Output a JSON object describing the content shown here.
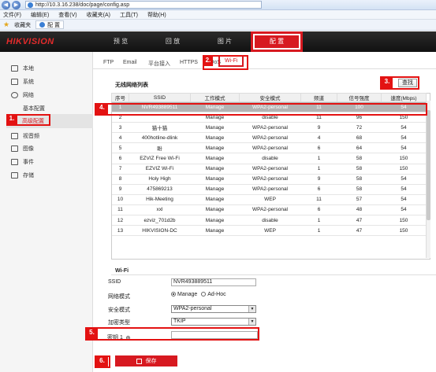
{
  "browser": {
    "url": "http://10.3.16.238/doc/page/config.asp",
    "menu": [
      "文件(F)",
      "编辑(E)",
      "查看(V)",
      "收藏夹(A)",
      "工具(T)",
      "帮助(H)"
    ],
    "favorites_label": "收藏夹",
    "tab_title": "配 置"
  },
  "app": {
    "logo": "HIKVISION",
    "main_tabs": [
      "预 览",
      "回 放",
      "图 片",
      "配 置"
    ]
  },
  "sidebar": {
    "local": "本地",
    "system": "系统",
    "network": "网络",
    "basic_config": "基本配置",
    "advanced_config": "高级配置",
    "video_audio": "视音频",
    "image": "图像",
    "event": "事件",
    "storage": "存储"
  },
  "subtabs": [
    "FTP",
    "Email",
    "平台接入",
    "HTTPS",
    "QoS",
    "Wi-Fi"
  ],
  "wifi_list": {
    "title": "无线网络列表",
    "search_label": "查找",
    "headers": [
      "序号",
      "SSID",
      "工作模式",
      "安全模式",
      "频道",
      "信号强度",
      "速度(Mbps)"
    ],
    "rows": [
      [
        "1",
        "NVR493889511",
        "Manage",
        "WPA2-personal",
        "11",
        "100",
        "54"
      ],
      [
        "2",
        "",
        "Manage",
        "disable",
        "11",
        "96",
        "150"
      ],
      [
        "3",
        "猫十猫",
        "Manage",
        "WPA2-personal",
        "9",
        "72",
        "54"
      ],
      [
        "4",
        "400hotline-dlink",
        "Manage",
        "WPA2-personal",
        "4",
        "68",
        "54"
      ],
      [
        "5",
        "盼",
        "Manage",
        "WPA2-personal",
        "6",
        "64",
        "54"
      ],
      [
        "6",
        "EZVIZ Free Wi-Fi",
        "Manage",
        "disable",
        "1",
        "58",
        "150"
      ],
      [
        "7",
        "EZVIZ Wi-Fi",
        "Manage",
        "WPA2-personal",
        "1",
        "58",
        "150"
      ],
      [
        "8",
        "Holy High",
        "Manage",
        "WPA2-personal",
        "9",
        "58",
        "54"
      ],
      [
        "9",
        "475869213",
        "Manage",
        "WPA2-personal",
        "6",
        "58",
        "54"
      ],
      [
        "10",
        "Hik-Meeting",
        "Manage",
        "WEP",
        "11",
        "57",
        "54"
      ],
      [
        "11",
        "xxl",
        "Manage",
        "WPA2-personal",
        "6",
        "48",
        "54"
      ],
      [
        "12",
        "ezviz_701d2b",
        "Manage",
        "disable",
        "1",
        "47",
        "150"
      ],
      [
        "13",
        "HIKVISION-DC",
        "Manage",
        "WEP",
        "1",
        "47",
        "150"
      ]
    ]
  },
  "wifi_form": {
    "title": "Wi-Fi",
    "ssid_label": "SSID",
    "ssid_value": "NVR493889511",
    "mode_label": "网络模式",
    "mode_manage": "Manage",
    "mode_adhoc": "Ad-Hoc",
    "security_label": "安全模式",
    "security_value": "WPA2-personal",
    "encryption_label": "加密类型",
    "encryption_value": "TKIP",
    "key_label": "密钥 1",
    "key_value": "",
    "save_label": "保存"
  },
  "annotations": [
    "1.",
    "2.",
    "3.",
    "4.",
    "5.",
    "6."
  ],
  "colors": {
    "brand_red": "#d71920",
    "annotation_red": "#e31212"
  }
}
